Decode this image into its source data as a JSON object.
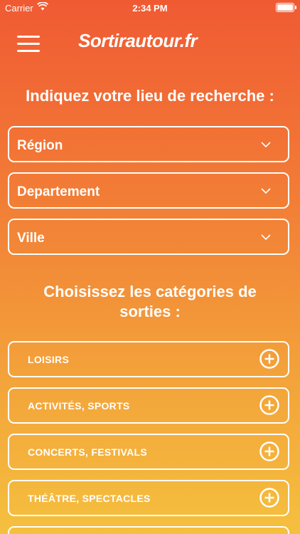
{
  "status_bar": {
    "carrier": "Carrier",
    "time": "2:34 PM"
  },
  "header": {
    "logo": "Sortirautour.fr"
  },
  "location": {
    "title": "Indiquez votre lieu de recherche :",
    "selects": [
      {
        "label": "Région"
      },
      {
        "label": "Departement"
      },
      {
        "label": "Ville"
      }
    ]
  },
  "categories": {
    "title": "Choisissez les catégories de sorties :",
    "items": [
      {
        "label": "LOISIRS"
      },
      {
        "label": "ACTIVITÉS, SPORTS"
      },
      {
        "label": "CONCERTS, FESTIVALS"
      },
      {
        "label": "THÉÂTRE, SPECTACLES"
      }
    ]
  }
}
